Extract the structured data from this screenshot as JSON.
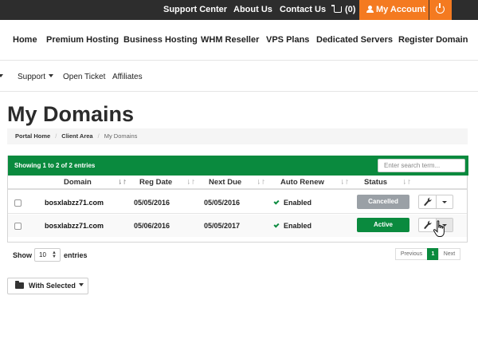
{
  "topbar": {
    "support_center": "Support Center",
    "about_us": "About Us",
    "contact_us": "Contact Us",
    "cart": "(0)",
    "my_account": "My Account"
  },
  "mainnav": {
    "items": [
      "Home",
      "Premium Hosting",
      "Business Hosting",
      "WHM Reseller",
      "VPS Plans",
      "Dedicated Servers",
      "Register Domain"
    ]
  },
  "subnav": {
    "support": "Support",
    "open_ticket": "Open Ticket",
    "affiliates": "Affiliates"
  },
  "page": {
    "title": "My Domains"
  },
  "breadcrumb": [
    "Portal Home",
    "Client Area",
    "My Domains"
  ],
  "table": {
    "info": "Showing 1 to 2 of 2 entries",
    "search_placeholder": "Enter search term...",
    "columns": [
      "Domain",
      "Reg Date",
      "Next Due",
      "Auto Renew",
      "Status"
    ],
    "rows": [
      {
        "domain": "bosxlabzz71.com",
        "reg_date": "05/05/2016",
        "next_due": "05/05/2016",
        "auto_renew": "Enabled",
        "status": "Cancelled"
      },
      {
        "domain": "bosxlabzz71.com",
        "reg_date": "05/06/2016",
        "next_due": "05/05/2017",
        "auto_renew": "Enabled",
        "status": "Active"
      }
    ]
  },
  "footer": {
    "show": "Show",
    "page_length": "10",
    "entries": "entries",
    "previous": "Previous",
    "page": "1",
    "next": "Next",
    "with_selected": "With Selected"
  },
  "colors": {
    "accent_orange": "#f47a20",
    "green": "#0a8a3e",
    "topbar": "#2d2d2d",
    "cancelled_grey": "#9aa0a6"
  }
}
